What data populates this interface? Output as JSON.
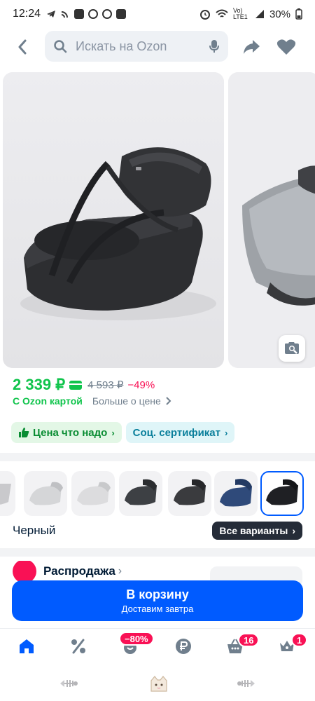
{
  "status_bar": {
    "time": "12:24",
    "network_label": "Vo) LTE1",
    "battery": "30%"
  },
  "search": {
    "placeholder": "Искать на Ozon"
  },
  "price": {
    "current": "2 339 ₽",
    "old": "4 593 ₽",
    "discount": "−49%",
    "ozon_card": "С Ozon картой",
    "more_about_price": "Больше о цене"
  },
  "chips": [
    {
      "label": "Цена что надо"
    },
    {
      "label": "Соц. сертификат"
    }
  ],
  "variants": {
    "color_name": "Черный",
    "all_variants_label": "Все варианты",
    "colors": [
      "#c9c9cc",
      "#d5d6d8",
      "#dcdcde",
      "#3d4044",
      "#3a3b3e",
      "#2f4a7a",
      "#1f2024"
    ]
  },
  "sale": {
    "title": "Распродажа"
  },
  "cart_button": {
    "label": "В корзину",
    "sub": "Доставим завтра"
  },
  "bottom_nav": {
    "badges": {
      "fresh": "−80%",
      "cart": "16",
      "profile": "1"
    }
  },
  "colors": {
    "accent": "#005bff",
    "price_green": "#10c44c",
    "discount_red": "#f91155"
  }
}
